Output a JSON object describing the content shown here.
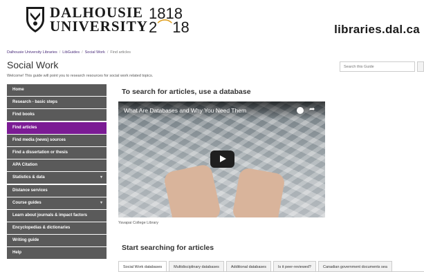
{
  "header": {
    "university_line1": "DALHOUSIE",
    "university_line2": "UNIVERSITY",
    "year_top": "1818",
    "year_bottom_prefix": "2",
    "year_bottom_arc": "⌒",
    "year_bottom_suffix": "18",
    "site_link": "libraries.dal.ca"
  },
  "breadcrumb": {
    "items": [
      "Dalhousie University Libraries",
      "LibGuides",
      "Social Work"
    ],
    "current": "Find articles",
    "separator": "/"
  },
  "page": {
    "title": "Social Work",
    "welcome": "Welcome! This guide will point you to research resources for social work related topics."
  },
  "search": {
    "placeholder": "Search this Guide"
  },
  "sidenav": {
    "items": [
      {
        "label": "Home"
      },
      {
        "label": "Research - basic steps"
      },
      {
        "label": "Find books"
      },
      {
        "label": "Find articles"
      },
      {
        "label": "Find media (news) sources"
      },
      {
        "label": "Find a dissertation or thesis"
      },
      {
        "label": "APA Citation"
      },
      {
        "label": "Statistics & data"
      },
      {
        "label": "Distance services"
      },
      {
        "label": "Course guides"
      },
      {
        "label": "Learn about journals & impact factors"
      },
      {
        "label": "Encyclopedias & dictionaries"
      },
      {
        "label": "Writing guide"
      },
      {
        "label": "Help"
      }
    ],
    "active_index": 3,
    "caret": "▾"
  },
  "main": {
    "section1_title": "To search for articles, use a database",
    "video_title": "What Are Databases and Why You Need Them",
    "video_caption": "Yavapai College Library",
    "section2_title": "Start searching for articles",
    "tabs": [
      {
        "label": "Social Work databases"
      },
      {
        "label": "Multidisciplinary databases"
      },
      {
        "label": "Additional databases"
      },
      {
        "label": "Is it peer-reviewed?"
      },
      {
        "label": "Canadian government documents sea"
      }
    ]
  },
  "colors": {
    "nav_bg": "#5a5a5a",
    "nav_active": "#7b1b94",
    "breadcrumb_link": "#4a2c7a",
    "year_accent": "#e0a020"
  }
}
